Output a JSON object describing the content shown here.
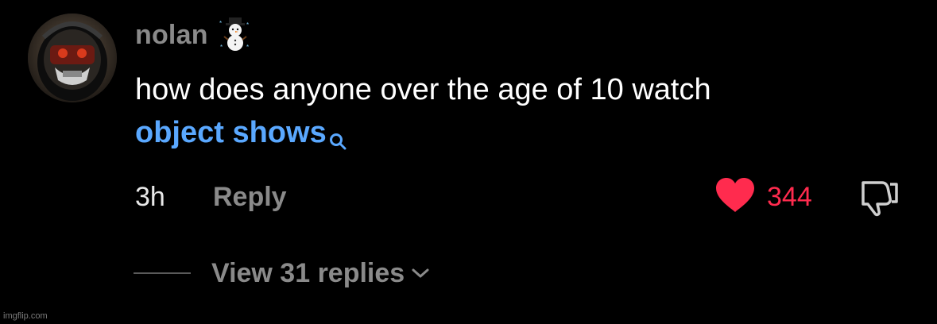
{
  "comment": {
    "username": "nolan",
    "username_emoji": "snowman-with-snowflakes-icon",
    "text": "how does anyone over the age of 10 watch",
    "search_term": "object shows",
    "time_ago": "3h",
    "reply_label": "Reply",
    "like_count": "344",
    "liked": true,
    "view_replies_label": "View 31 replies"
  },
  "watermark": "imgflip.com",
  "colors": {
    "background": "#000000",
    "username": "#8a8a8a",
    "link": "#5aa8ff",
    "like": "#ff2b4e"
  }
}
